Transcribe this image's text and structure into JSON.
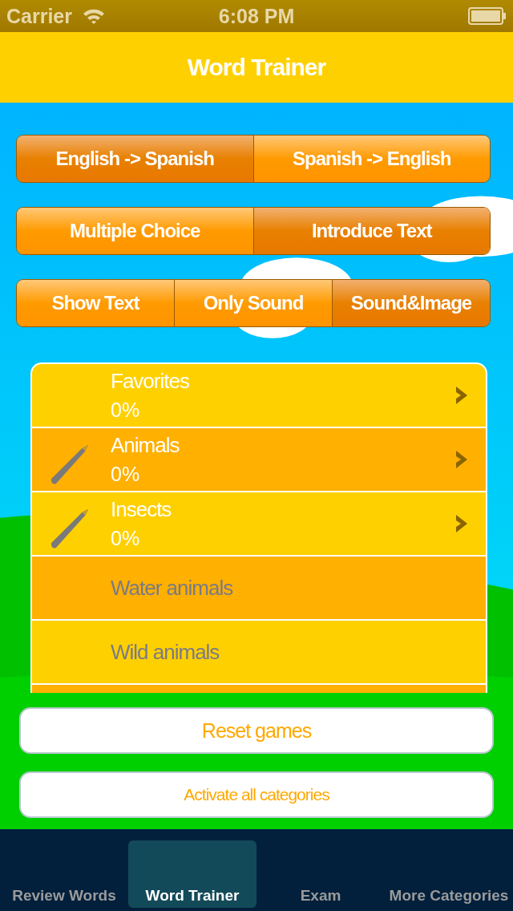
{
  "status_bar": {
    "carrier": "Carrier",
    "time": "6:08 PM"
  },
  "nav_bar": {
    "title": "Word Trainer"
  },
  "segment_groups": [
    {
      "segments": [
        {
          "label": "English -> Spanish",
          "selected": true
        },
        {
          "label": "Spanish -> English",
          "selected": false
        }
      ]
    },
    {
      "segments": [
        {
          "label": "Multiple Choice",
          "selected": false
        },
        {
          "label": "Introduce Text",
          "selected": true
        }
      ]
    },
    {
      "segments": [
        {
          "label": "Show Text",
          "selected": false
        },
        {
          "label": "Only Sound",
          "selected": false
        },
        {
          "label": "Sound&Image",
          "selected": true
        }
      ]
    }
  ],
  "categories": [
    {
      "name": "Favorites",
      "progress": "0%",
      "enabled": true,
      "pencil": false
    },
    {
      "name": "Animals",
      "progress": "0%",
      "enabled": true,
      "pencil": true
    },
    {
      "name": "Insects",
      "progress": "0%",
      "enabled": true,
      "pencil": true
    },
    {
      "name": "Water animals",
      "enabled": false,
      "pencil": false
    },
    {
      "name": "Wild animals",
      "enabled": false,
      "pencil": false
    }
  ],
  "buttons": [
    {
      "label": "Reset games"
    },
    {
      "label": "Activate all categories"
    }
  ],
  "tabs": [
    {
      "label": "Review Words",
      "selected": false
    },
    {
      "label": "Word Trainer",
      "selected": true
    },
    {
      "label": "Exam",
      "selected": false
    },
    {
      "label": "More Categories",
      "selected": false
    }
  ]
}
